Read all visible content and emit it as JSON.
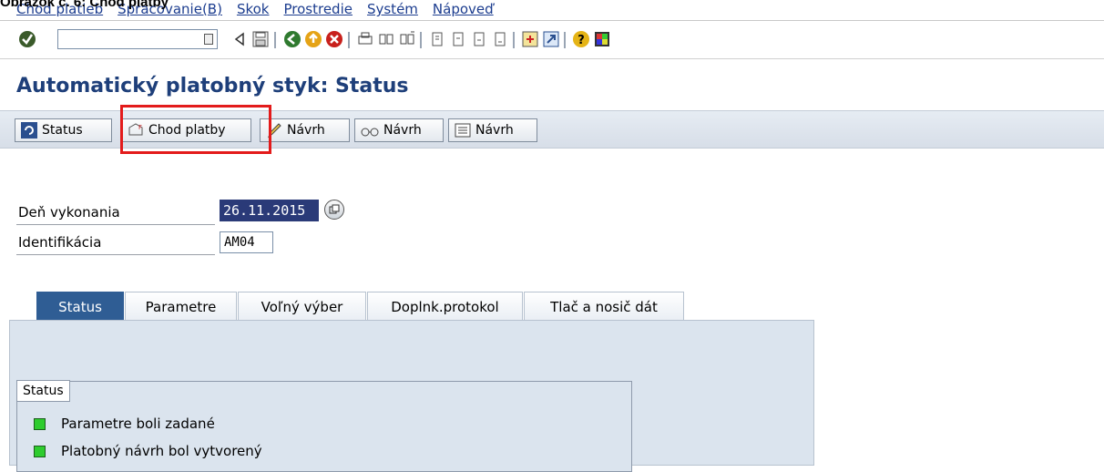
{
  "caption": "Obrázok č. 6: Chod platby",
  "menu": [
    "Chod platieb",
    "Spracovanie(B)",
    "Skok",
    "Prostredie",
    "Systém",
    "Nápoveď"
  ],
  "title": "Automatický platobný styk: Status",
  "app_buttons": {
    "status": "Status",
    "chod_platby": "Chod platby",
    "navrh_edit": "Návrh",
    "navrh_display": "Návrh",
    "navrh_list": "Návrh"
  },
  "fields": {
    "date_label": "Deň vykonania",
    "date_value": "26.11.2015",
    "id_label": "Identifikácia",
    "id_value": "AM04"
  },
  "tabs": [
    "Status",
    "Parametre",
    "Voľný výber",
    "Doplnk.protokol",
    "Tlač a nosič dát"
  ],
  "status_group": {
    "title": "Status",
    "items": [
      "Parametre boli zadané",
      "Platobný návrh bol vytvorený"
    ]
  },
  "colors": {
    "highlight": "#e31b1b",
    "title": "#1e3f7a",
    "active_tab": "#2f5d94",
    "led_green": "#2ecc2e"
  }
}
